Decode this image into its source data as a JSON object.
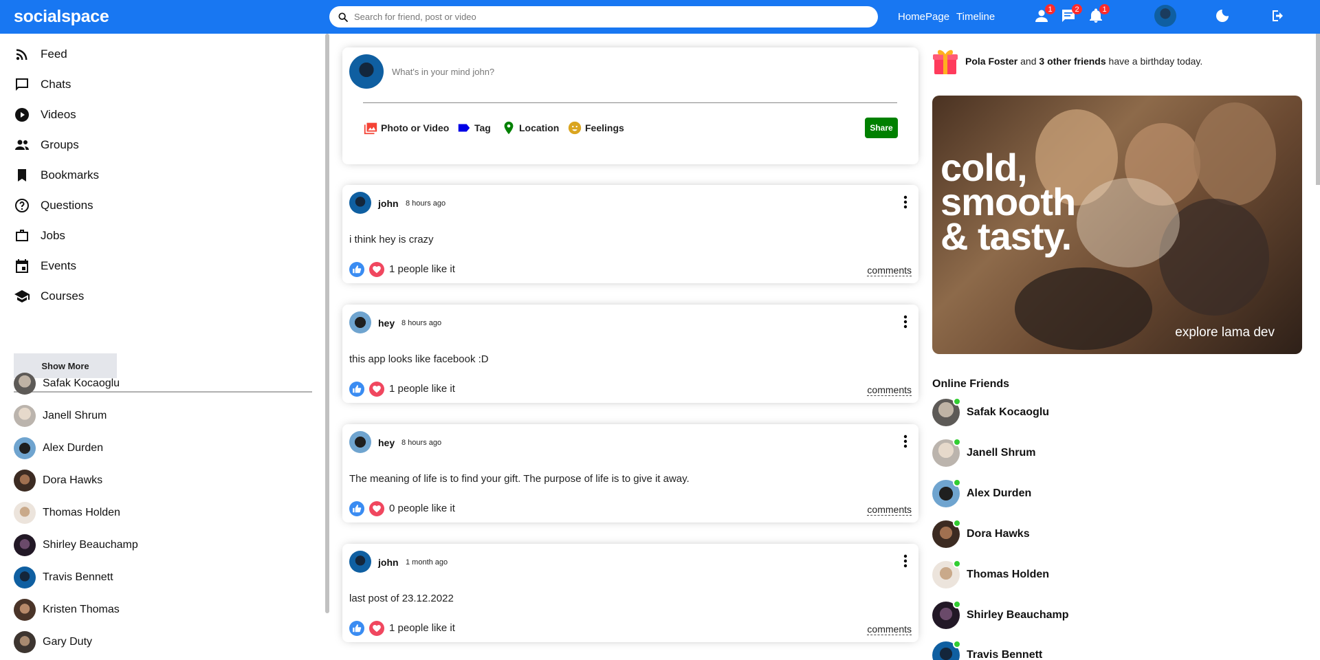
{
  "app": {
    "logo": "socialspace"
  },
  "search": {
    "placeholder": "Search for friend, post or video"
  },
  "topnav": {
    "links": [
      "HomePage",
      "Timeline"
    ],
    "badges": {
      "friends": "1",
      "messages": "2",
      "notifications": "1"
    }
  },
  "sidebar": {
    "items": [
      {
        "label": "Feed",
        "icon": "rss-icon"
      },
      {
        "label": "Chats",
        "icon": "chat-icon"
      },
      {
        "label": "Videos",
        "icon": "play-circle-icon"
      },
      {
        "label": "Groups",
        "icon": "group-icon"
      },
      {
        "label": "Bookmarks",
        "icon": "bookmark-icon"
      },
      {
        "label": "Questions",
        "icon": "help-circle-icon"
      },
      {
        "label": "Jobs",
        "icon": "briefcase-icon"
      },
      {
        "label": "Events",
        "icon": "calendar-icon"
      },
      {
        "label": "Courses",
        "icon": "school-icon"
      }
    ],
    "show_more": "Show More",
    "friends": [
      "Safak Kocaoglu",
      "Janell Shrum",
      "Alex Durden",
      "Dora Hawks",
      "Thomas Holden",
      "Shirley Beauchamp",
      "Travis Bennett",
      "Kristen Thomas",
      "Gary Duty"
    ]
  },
  "share": {
    "placeholder": "What's in your mind john?",
    "options": [
      "Photo or Video",
      "Tag",
      "Location",
      "Feelings"
    ],
    "button": "Share"
  },
  "posts": [
    {
      "user": "john",
      "time": "8 hours ago",
      "text": "i think hey is crazy",
      "likes": "1 people like it",
      "comments": "comments"
    },
    {
      "user": "hey",
      "time": "8 hours ago",
      "text": "this app looks like facebook :D",
      "likes": "1 people like it",
      "comments": "comments"
    },
    {
      "user": "hey",
      "time": "8 hours ago",
      "text": "The meaning of life is to find your gift. The purpose of life is to give it away.",
      "likes": "0 people like it",
      "comments": "comments"
    },
    {
      "user": "john",
      "time": "1 month ago",
      "text": "last post of 23.12.2022",
      "likes": "1 people like it",
      "comments": "comments"
    }
  ],
  "birthday": {
    "name": "Pola Foster",
    "mid": "and",
    "count": "3 other friends",
    "rest": "have a birthday today."
  },
  "ad": {
    "headline_1": "cold,",
    "headline_2": "smooth",
    "headline_3": "& tasty.",
    "tagline": "explore lama dev"
  },
  "online": {
    "title": "Online Friends",
    "friends": [
      "Safak Kocaoglu",
      "Janell Shrum",
      "Alex Durden",
      "Dora Hawks",
      "Thomas Holden",
      "Shirley Beauchamp",
      "Travis Bennett"
    ]
  },
  "colors": {
    "primary": "#1877f2",
    "share": "#008000",
    "online": "#32cd32",
    "badge": "#ff2b2b"
  }
}
